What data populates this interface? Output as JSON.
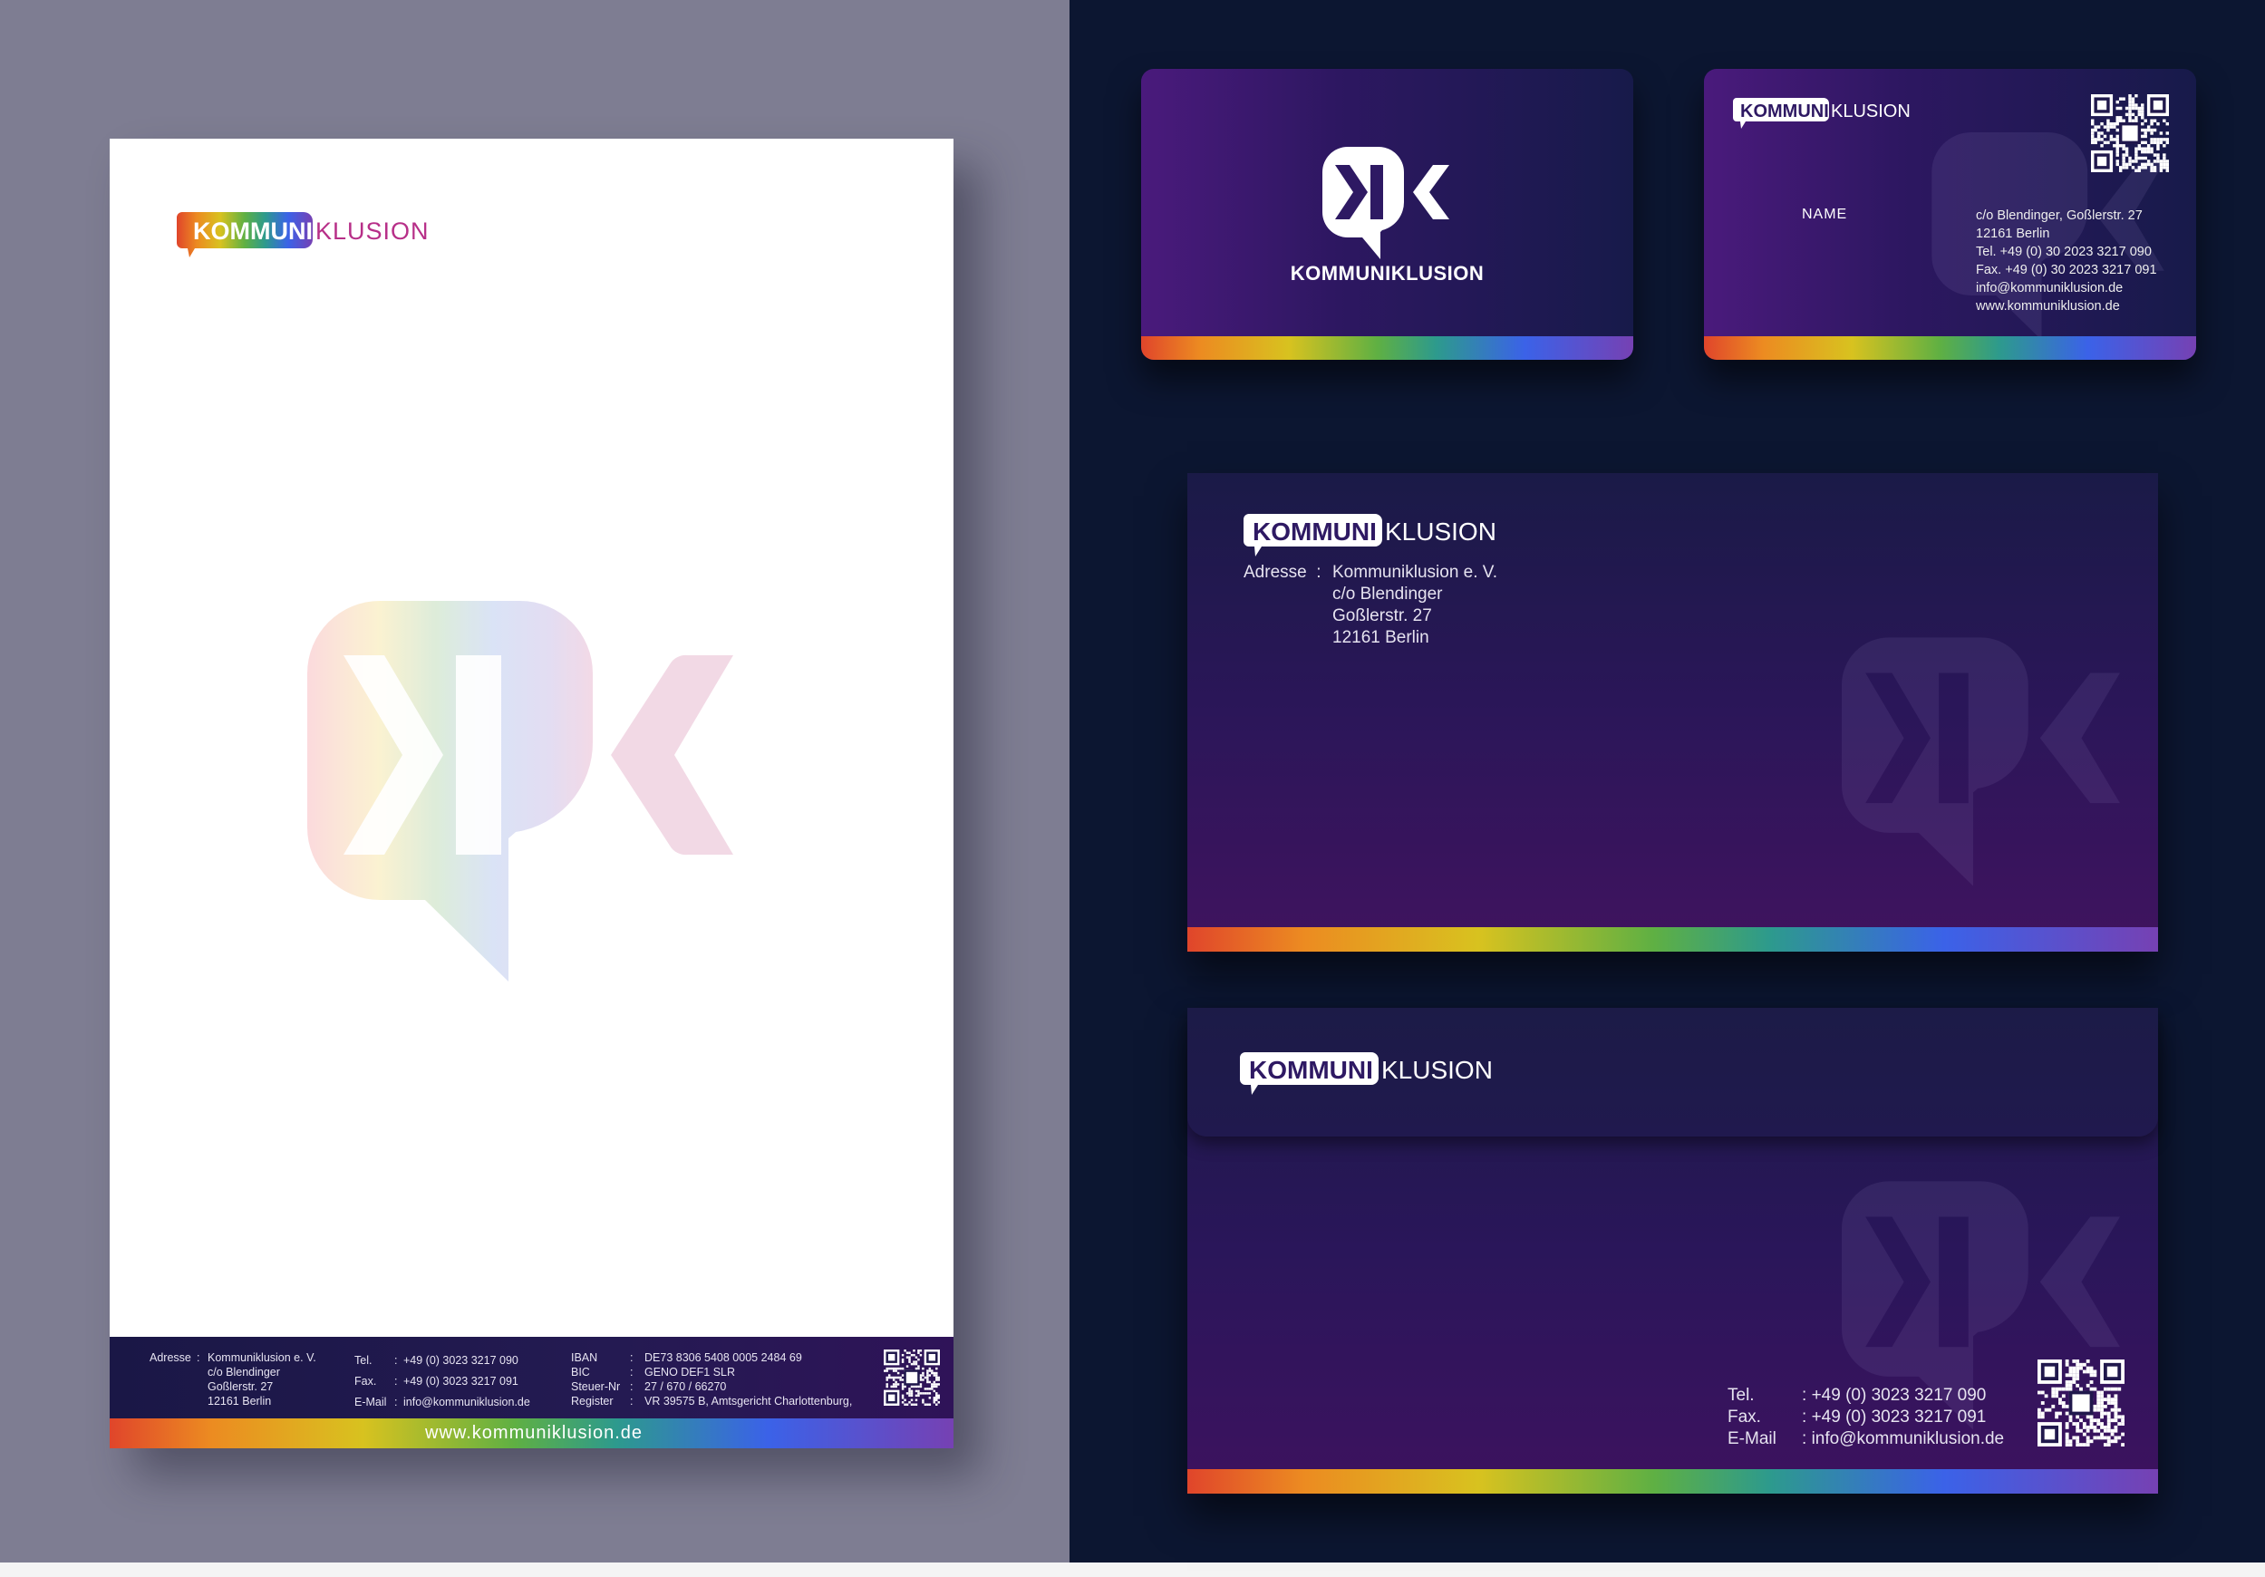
{
  "brand": {
    "logo_part1": "KOMMUNI",
    "logo_part2": "KLUSION",
    "wordmark": "KOMMUNIKLUSION"
  },
  "letterhead": {
    "footer": {
      "address_label": "Adresse",
      "address_lines": [
        "Kommuniklusion e. V.",
        "c/o Blendinger",
        "Goßlerstr. 27",
        "12161 Berlin"
      ],
      "tel_label": "Tel.",
      "tel": "+49 (0) 3023 3217 090",
      "fax_label": "Fax.",
      "fax": "+49 (0) 3023 3217 091",
      "email_label": "E-Mail",
      "email": "info@kommuniklusion.de",
      "iban_label": "IBAN",
      "iban": "DE73 8306 5408 0005 2484 69",
      "bic_label": "BIC",
      "bic": "GENO DEF1 SLR",
      "tax_label": "Steuer-Nr",
      "tax": "27 / 670 / 66270",
      "register_label": "Register",
      "register": "VR 39575 B, Amtsgericht Charlottenburg,"
    },
    "website": "www.kommuniklusion.de"
  },
  "business_card_back": {
    "name_label": "NAME",
    "info_lines": [
      "c/o Blendinger, Goßlerstr. 27",
      "12161 Berlin",
      "Tel.  +49 (0) 30 2023 3217 090",
      "Fax. +49 (0) 30 2023 3217 091",
      "info@kommuniklusion.de",
      "www.kommuniklusion.de"
    ]
  },
  "envelope_front": {
    "address_label": "Adresse",
    "address_lines": [
      "Kommuniklusion e. V.",
      "c/o Blendinger",
      "Goßlerstr. 27",
      "12161 Berlin"
    ]
  },
  "envelope_back": {
    "tel_label": "Tel.",
    "tel": "+49 (0) 3023 3217 090",
    "fax_label": "Fax.",
    "fax": "+49 (0) 3023 3217 091",
    "email_label": "E-Mail",
    "email": "info@kommuniklusion.de"
  },
  "colors": {
    "navy": "#0c1631",
    "purple": "#40135f",
    "gray_bg": "#7e7d92"
  }
}
